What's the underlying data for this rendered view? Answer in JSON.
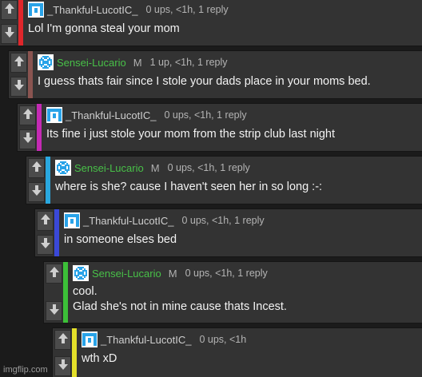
{
  "colors": {
    "background": "#1b1b1b",
    "card": "#333333",
    "username_green": "#48c048",
    "user_avatar": "#29a3e8"
  },
  "comments": [
    {
      "user": "_Thankful-LucotIC_",
      "meta": "0 ups, <1h, 1 reply",
      "lines": [
        "Lol I'm gonna steal your mom"
      ],
      "bar_color": "#e0262b",
      "avatar": "flag-avatar-icon",
      "mod": ""
    },
    {
      "user": "Sensei-Lucario",
      "meta": "1 up, <1h, 1 reply",
      "lines": [
        "I guess thats fair since I stole your dads place in your moms bed."
      ],
      "bar_color": "#8a5450",
      "avatar": "checker-avatar-icon",
      "mod": "M"
    },
    {
      "user": "_Thankful-LucotIC_",
      "meta": "0 ups, <1h, 1 reply",
      "lines": [
        "Its fine i just stole your mom from the strip club last night"
      ],
      "bar_color": "#c42ab4",
      "avatar": "flag-avatar-icon",
      "mod": ""
    },
    {
      "user": "Sensei-Lucario",
      "meta": "0 ups, <1h, 1 reply",
      "lines": [
        "where is she? cause I haven't seen her in so long :-:"
      ],
      "bar_color": "#2aa8e0",
      "avatar": "checker-avatar-icon",
      "mod": "M"
    },
    {
      "user": "_Thankful-LucotIC_",
      "meta": "0 ups, <1h, 1 reply",
      "lines": [
        "in someone elses bed"
      ],
      "bar_color": "#3a48d8",
      "avatar": "flag-avatar-icon",
      "mod": ""
    },
    {
      "user": "Sensei-Lucario",
      "meta": "0 ups, <1h, 1 reply",
      "lines": [
        "cool.",
        "Glad she's not in mine cause thats Incest."
      ],
      "bar_color": "#3cc038",
      "avatar": "checker-avatar-icon",
      "mod": "M"
    },
    {
      "user": "_Thankful-LucotIC_",
      "meta": "0 ups, <1h",
      "lines": [
        "wth xD"
      ],
      "bar_color": "#e4e02a",
      "avatar": "flag-avatar-icon",
      "mod": ""
    }
  ],
  "watermark": "imgflip.com"
}
